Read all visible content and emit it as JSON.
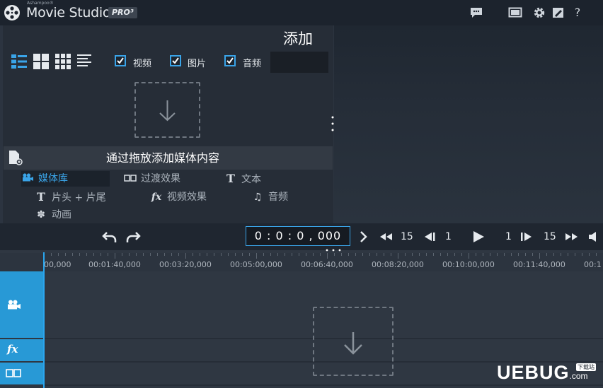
{
  "header": {
    "brand_small": "Ashampoo®",
    "app_name": "Movie Studio",
    "pro_badge": "PRO³",
    "icons": [
      "chat-icon",
      "fullscreen-icon",
      "gear-icon",
      "edit-icon",
      "help-icon"
    ],
    "help_label": "?"
  },
  "panel": {
    "title": "添加",
    "filters": [
      {
        "label": "视频",
        "checked": true
      },
      {
        "label": "图片",
        "checked": true
      },
      {
        "label": "音频",
        "checked": true
      }
    ],
    "drop_hint": "通过拖放添加媒体内容",
    "categories": [
      {
        "label": "媒体库",
        "icon": "camera-icon",
        "active": true
      },
      {
        "label": "过渡效果",
        "icon": "transition-icon"
      },
      {
        "label": "文本",
        "icon": "text-icon",
        "glyph": "T"
      },
      {
        "label": "片头 + 片尾",
        "icon": "title-icon",
        "glyph": "T"
      },
      {
        "label": "视频效果",
        "icon": "fx-icon",
        "glyph": "fx"
      },
      {
        "label": "音频",
        "icon": "music-note-icon",
        "glyph": "♫"
      },
      {
        "label": "动画",
        "icon": "flower-icon",
        "glyph": "✽"
      }
    ]
  },
  "transport": {
    "timecode": "0 : 0 : 0 , 000",
    "step_back_large": "15",
    "step_back_small": "1",
    "step_fwd_small": "1",
    "step_fwd_large": "15"
  },
  "timeline": {
    "ticks": [
      "00,000",
      "00:01:40,000",
      "00:03:20,000",
      "00:05:00,000",
      "00:06:40,000",
      "00:08:20,000",
      "00:10:00,000",
      "00:11:40,000",
      "00:1"
    ],
    "tracks": [
      "video-track",
      "fx-track",
      "transition-track"
    ]
  },
  "watermark": {
    "text": "UEBUG",
    "suffix": ".com",
    "badge": "下载站"
  },
  "colors": {
    "accent": "#2899d6",
    "background": "#2c3440",
    "titlebar": "#1c232d"
  }
}
